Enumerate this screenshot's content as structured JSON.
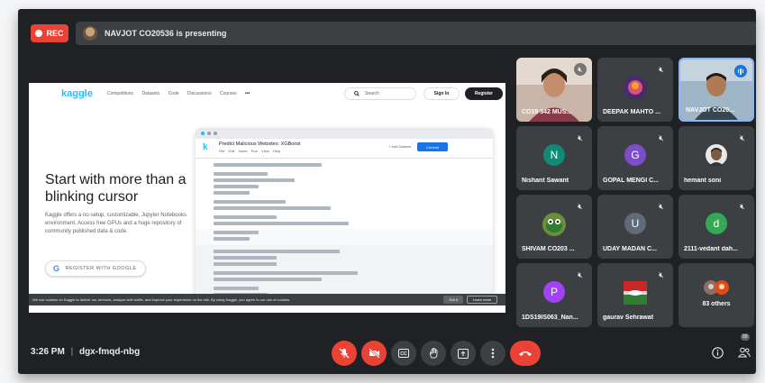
{
  "topbar": {
    "rec_label": "REC",
    "presenting_text": "NAVJOT CO20536 is presenting"
  },
  "kaggle": {
    "logo": "kaggle",
    "nav": [
      "Competitions",
      "Datasets",
      "Code",
      "Discussions",
      "Courses",
      "•••"
    ],
    "search_placeholder": "Search",
    "sign_in": "Sign In",
    "register": "Register",
    "hero_title": "Start with more than a blinking cursor",
    "hero_subtitle": "Kaggle offers a no-setup, customizable, Jupyter Notebooks environment. Access free GPUs and a huge repository of community published data & code.",
    "google_button": "REGISTER WITH GOOGLE",
    "notebook_title": "Predict Malicious Websites: XGBoost",
    "notebook_menu": "File Edit Insert Run View Help",
    "add_dataset": "+ Add Dataset",
    "commit_button": "Commit",
    "cookie_text": "We use cookies on Kaggle to deliver our services, analyze web traffic, and improve your experience on the site. By using Kaggle, you agree to our use of cookies.",
    "cookie_got_it": "Got it",
    "cookie_learn_more": "Learn more"
  },
  "participants": [
    {
      "name": "CO19 342 MUS...",
      "type": "photo",
      "muted": true
    },
    {
      "name": "DEEPAK MAHTO ...",
      "type": "photo",
      "muted": true
    },
    {
      "name": "NAVJOT CO20...",
      "type": "photo",
      "speaking": true
    },
    {
      "name": "Nishant Sawant",
      "initial": "N",
      "color": "#0f8a76",
      "muted": true
    },
    {
      "name": "GOPAL MENGI C...",
      "initial": "G",
      "color": "#7c4dcb",
      "muted": true
    },
    {
      "name": "hemant soni",
      "type": "avatar",
      "muted": true
    },
    {
      "name": "SHIVAM CO203 ...",
      "type": "avatar",
      "muted": true
    },
    {
      "name": "UDAY MADAN C...",
      "initial": "U",
      "color": "#5f6b7a",
      "muted": true
    },
    {
      "name": "2111-vedant dah...",
      "initial": "d",
      "color": "#34a853",
      "muted": true
    },
    {
      "name": "1DS19IS063_Nan...",
      "initial": "P",
      "color": "#a142f4",
      "muted": true
    },
    {
      "name": "gaurav Sehrawat",
      "type": "avatar",
      "muted": true
    },
    {
      "name": "83 others",
      "type": "others"
    }
  ],
  "bottom": {
    "time": "3:26 PM",
    "separator": "|",
    "meeting_code": "dgx-fmqd-nbg",
    "people_count": "99"
  },
  "colors": {
    "background": "#202124",
    "tile": "#3c4043",
    "red": "#ea4335",
    "kaggle_blue": "#20beff"
  }
}
